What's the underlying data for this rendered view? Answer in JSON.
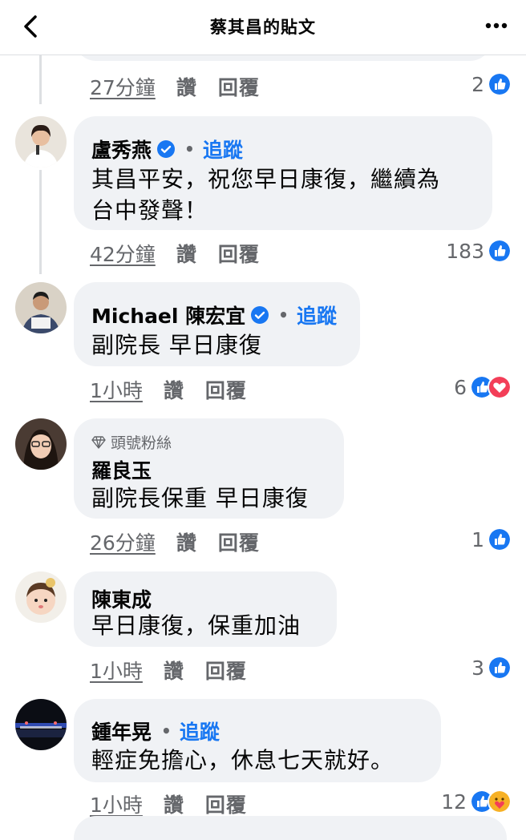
{
  "header": {
    "title": "蔡其昌的貼文"
  },
  "actions": {
    "like": "讚",
    "reply": "回覆",
    "follow": "追蹤"
  },
  "prev_comment": {
    "time": "27分鐘",
    "reaction_count": "2"
  },
  "comments": [
    {
      "name": "盧秀燕",
      "verified": true,
      "follow": true,
      "text_lines": [
        "其昌平安，祝您早日康復，繼續為",
        "台中發聲！"
      ],
      "time": "42分鐘",
      "reaction_count": "183",
      "reactions": [
        "like"
      ]
    },
    {
      "name": "Michael 陳宏宜",
      "verified": true,
      "follow": true,
      "text_lines": [
        "副院長 早日康復"
      ],
      "time": "1小時",
      "reaction_count": "6",
      "reactions": [
        "like",
        "love"
      ]
    },
    {
      "name": "羅良玉",
      "badge": "頭號粉絲",
      "text_lines": [
        "副院長保重 早日康復"
      ],
      "time": "26分鐘",
      "reaction_count": "1",
      "reactions": [
        "like"
      ]
    },
    {
      "name": "陳東成",
      "text_lines": [
        "早日康復，保重加油"
      ],
      "time": "1小時",
      "reaction_count": "3",
      "reactions": [
        "like"
      ]
    },
    {
      "name": "鍾年晃",
      "follow": true,
      "text_lines": [
        "輕症免擔心，休息七天就好。"
      ],
      "time": "1小時",
      "reaction_count": "12",
      "reactions": [
        "like",
        "care"
      ]
    }
  ],
  "icons": {
    "back": "chevron-left-icon",
    "more": "more-dots-icon",
    "verified": "verified-badge-icon",
    "fan_badge": "diamond-icon"
  },
  "colors": {
    "accent": "#1877f2",
    "bubble": "#f0f2f5",
    "love": "#f33e58",
    "care": "#f7b125"
  }
}
